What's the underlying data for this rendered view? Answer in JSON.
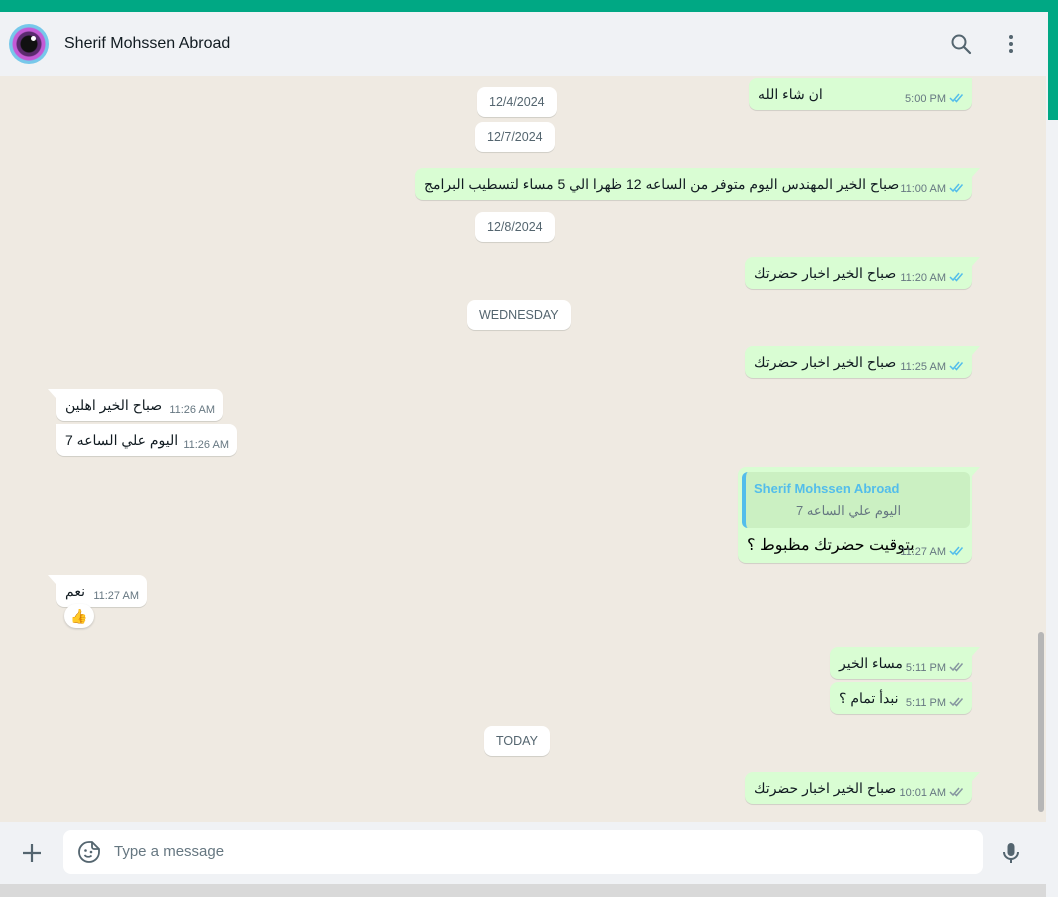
{
  "header": {
    "contact_name": "Sherif Mohssen Abroad"
  },
  "icons": {
    "search": "search-icon",
    "menu": "menu-icon",
    "attach": "plus-icon",
    "sticker": "sticker-icon",
    "mic": "mic-icon",
    "ticks": "double-check-icon"
  },
  "colors": {
    "accent": "#00a884",
    "outgoing": "#d9fdd3",
    "incoming": "#ffffff",
    "tick_read": "#53bdeb",
    "reply_name": "#53bdeb"
  },
  "messages": {
    "m1": {
      "text": "ان شاء الله",
      "time": "5:00 PM"
    },
    "d1": "12/4/2024",
    "d2": "12/7/2024",
    "m2": {
      "text": "صباح الخير المهندس اليوم متوفر من الساعه 12 ظهرا الي 5 مساء لتسطيب البرامج",
      "time": "11:00 AM"
    },
    "d3": "12/8/2024",
    "m3": {
      "text": "صباح الخير اخبار حضرتك",
      "time": "11:20 AM"
    },
    "d4": "WEDNESDAY",
    "m4": {
      "text": "صباح الخير اخبار حضرتك",
      "time": "11:25 AM"
    },
    "m5": {
      "text": "صباح الخير اهلين",
      "time": "11:26 AM"
    },
    "m6": {
      "text": "اليوم علي الساعه 7",
      "time": "11:26 AM"
    },
    "m7": {
      "reply_name": "Sherif Mohssen Abroad",
      "reply_text": "اليوم علي الساعه 7",
      "text": "بتوقيت حضرتك مظبوط ؟",
      "time": "11:27 AM"
    },
    "m8": {
      "text": "نعم",
      "time": "11:27 AM",
      "reaction": "👍"
    },
    "m9": {
      "text": "مساء الخير",
      "time": "5:11 PM"
    },
    "m10": {
      "text": "نبدأ تمام ؟",
      "time": "5:11 PM"
    },
    "d5": "TODAY",
    "m11": {
      "text": "صباح الخير اخبار حضرتك",
      "time": "10:01 AM"
    }
  },
  "composer": {
    "placeholder": "Type a message"
  }
}
